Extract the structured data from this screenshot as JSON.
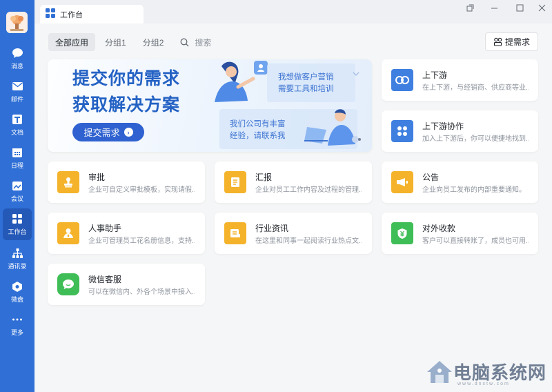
{
  "sidebar": {
    "items": [
      {
        "label": "消息",
        "icon": "chat-icon"
      },
      {
        "label": "邮件",
        "icon": "mail-icon"
      },
      {
        "label": "文档",
        "icon": "doc-icon"
      },
      {
        "label": "日程",
        "icon": "calendar-icon"
      },
      {
        "label": "会议",
        "icon": "meeting-icon"
      },
      {
        "label": "工作台",
        "icon": "workbench-icon",
        "active": true
      },
      {
        "label": "通讯录",
        "icon": "contacts-icon"
      },
      {
        "label": "微盘",
        "icon": "drive-icon"
      },
      {
        "label": "更多",
        "icon": "more-icon"
      }
    ]
  },
  "tab": {
    "label": "工作台"
  },
  "filters": {
    "all": "全部应用",
    "group1": "分组1",
    "group2": "分组2",
    "search": "搜索"
  },
  "actions": {
    "submit_request": "提需求"
  },
  "banner": {
    "line1": "提交你的需求",
    "line2": "获取解决方案",
    "button": "提交需求",
    "bubble1_line1": "我想做客户营销",
    "bubble1_line2": "需要工具和培训",
    "bubble2_line1": "我们公司有丰富",
    "bubble2_line2": "经验，请联系我"
  },
  "apps": {
    "updown": {
      "name": "上下游",
      "desc": "在上下游，与经销商、供应商等业..."
    },
    "updown_collab": {
      "name": "上下游协作",
      "desc": "加入上下游后，你可以便捷地找到..."
    },
    "approval": {
      "name": "审批",
      "desc": "企业可自定义审批模板，实现请假..."
    },
    "report": {
      "name": "汇报",
      "desc": "企业对员工工作内容及过程的管理..."
    },
    "notice": {
      "name": "公告",
      "desc": "企业向员工发布的内部重要通知。"
    },
    "hr": {
      "name": "人事助手",
      "desc": "企业可管理员工花名册信息，支持..."
    },
    "news": {
      "name": "行业资讯",
      "desc": "在这里和同事一起阅读行业热点文..."
    },
    "payment": {
      "name": "对外收款",
      "desc": "客户可以直接转账了，成员也可用..."
    },
    "wechat_service": {
      "name": "微信客服",
      "desc": "可以在微信内、外各个场景中接入..."
    }
  },
  "watermark": {
    "title": "电脑系统网",
    "url": "www.dnxtw.com"
  },
  "colors": {
    "sidebar": "#2f6fd6",
    "yellow": "#f4b32a",
    "green": "#3fbd56",
    "blue": "#3f7fe0",
    "brand_text": "#2462c4"
  }
}
